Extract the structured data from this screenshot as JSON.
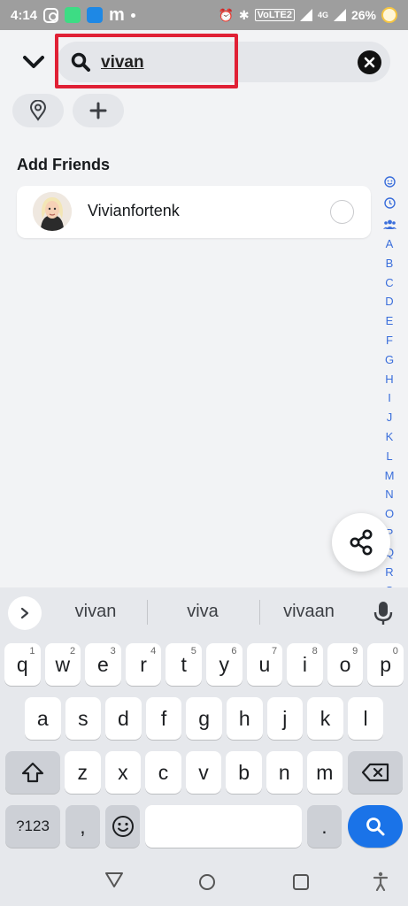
{
  "status_bar": {
    "time": "4:14",
    "battery": "26%",
    "network": "4G",
    "volte": "VoLTE2"
  },
  "search": {
    "value": "vivan",
    "placeholder": ""
  },
  "section": {
    "title": "Add Friends"
  },
  "friends": [
    {
      "name": "Vivianfortenk"
    }
  ],
  "alpha_index": [
    "A",
    "B",
    "C",
    "D",
    "E",
    "F",
    "G",
    "H",
    "I",
    "J",
    "K",
    "L",
    "M",
    "N",
    "O",
    "P",
    "Q",
    "R",
    "S"
  ],
  "keyboard": {
    "suggestions": [
      "vivan",
      "viva",
      "vivaan"
    ],
    "row1": [
      {
        "k": "q",
        "h": "1"
      },
      {
        "k": "w",
        "h": "2"
      },
      {
        "k": "e",
        "h": "3"
      },
      {
        "k": "r",
        "h": "4"
      },
      {
        "k": "t",
        "h": "5"
      },
      {
        "k": "y",
        "h": "6"
      },
      {
        "k": "u",
        "h": "7"
      },
      {
        "k": "i",
        "h": "8"
      },
      {
        "k": "o",
        "h": "9"
      },
      {
        "k": "p",
        "h": "0"
      }
    ],
    "row2": [
      "a",
      "s",
      "d",
      "f",
      "g",
      "h",
      "j",
      "k",
      "l"
    ],
    "row3": [
      "z",
      "x",
      "c",
      "v",
      "b",
      "n",
      "m"
    ],
    "symbols_label": "?123",
    "comma": ",",
    "period": "."
  },
  "colors": {
    "highlight_border": "#e02035",
    "accent_blue": "#1a73e8",
    "index_blue": "#3a6edb"
  }
}
